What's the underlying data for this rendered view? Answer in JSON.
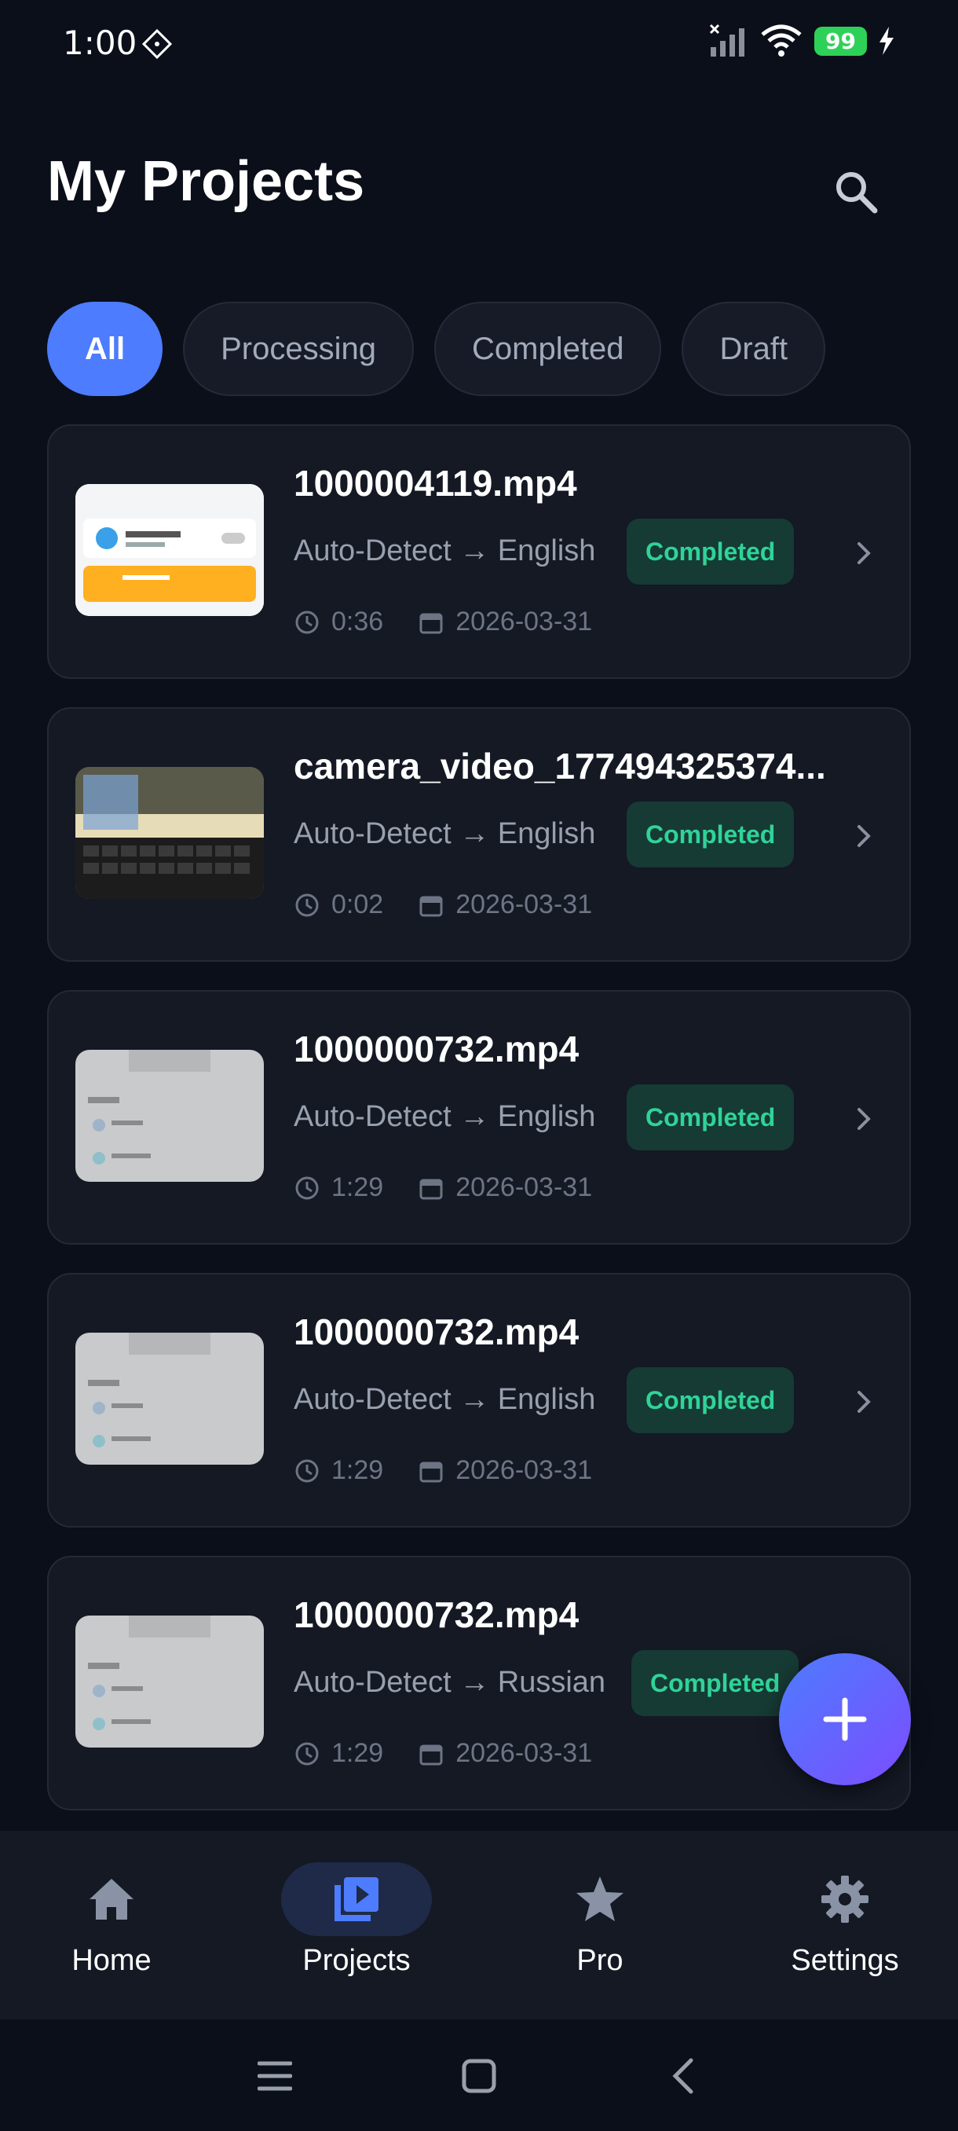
{
  "status_bar": {
    "time": "1:00",
    "battery": "99"
  },
  "header": {
    "title": "My Projects"
  },
  "filters": [
    {
      "label": "All",
      "active": true
    },
    {
      "label": "Processing",
      "active": false
    },
    {
      "label": "Completed",
      "active": false
    },
    {
      "label": "Draft",
      "active": false
    }
  ],
  "projects": [
    {
      "title": "1000004119.mp4",
      "languages": "Auto-Detect → English",
      "status": "Completed",
      "duration": "0:36",
      "date": "2026-03-31"
    },
    {
      "title": "camera_video_177494325374...",
      "languages": "Auto-Detect → English",
      "status": "Completed",
      "duration": "0:02",
      "date": "2026-03-31"
    },
    {
      "title": "1000000732.mp4",
      "languages": "Auto-Detect → English",
      "status": "Completed",
      "duration": "1:29",
      "date": "2026-03-31"
    },
    {
      "title": "1000000732.mp4",
      "languages": "Auto-Detect → English",
      "status": "Completed",
      "duration": "1:29",
      "date": "2026-03-31"
    },
    {
      "title": "1000000732.mp4",
      "languages": "Auto-Detect → Russian",
      "status": "Completed",
      "duration": "1:29",
      "date": "2026-03-31"
    }
  ],
  "bottom_nav": [
    {
      "label": "Home",
      "icon": "home-icon",
      "active": false
    },
    {
      "label": "Projects",
      "icon": "projects-icon",
      "active": true
    },
    {
      "label": "Pro",
      "icon": "star-icon",
      "active": false
    },
    {
      "label": "Settings",
      "icon": "gear-icon",
      "active": false
    }
  ],
  "colors": {
    "accent": "#4d7cfe",
    "background": "#0b0f1a",
    "card": "#141924",
    "success": "#2fd398",
    "fab_gradient_end": "#7c4dff"
  }
}
